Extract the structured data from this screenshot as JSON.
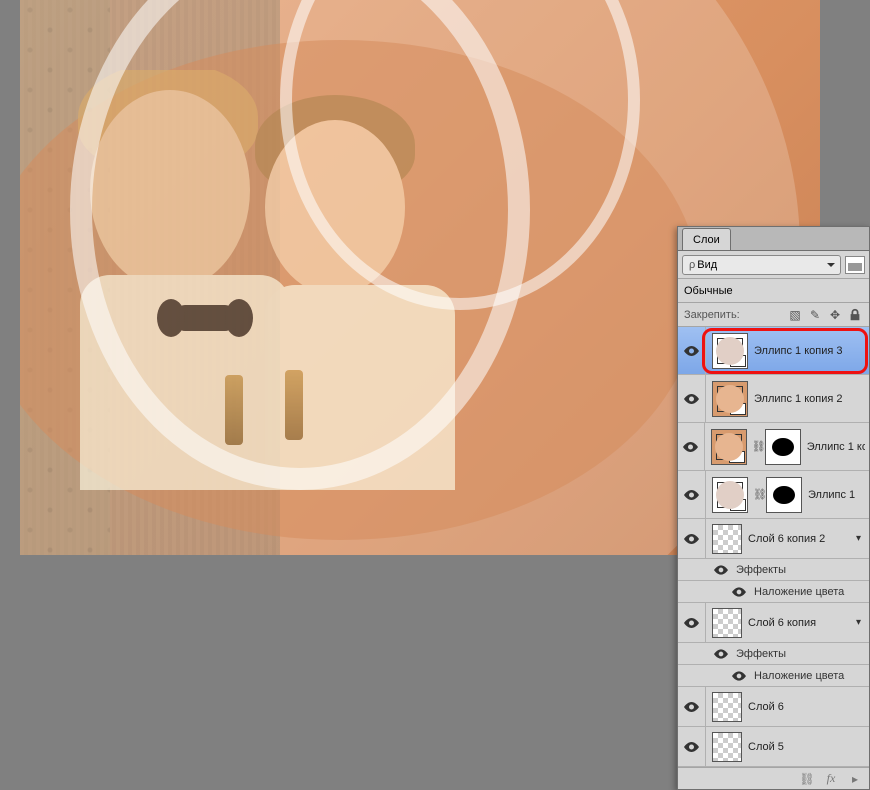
{
  "panel": {
    "tab_label": "Слои",
    "filter_prefix": "ρ",
    "filter_label": "Вид",
    "blend_mode": "Обычные",
    "lock_label": "Закрепить:"
  },
  "layers": [
    {
      "name": "Эллипс 1 копия 3",
      "selected": true,
      "type": "shape"
    },
    {
      "name": "Эллипс 1 копия 2",
      "selected": false,
      "type": "shape-brown"
    },
    {
      "name": "Эллипс 1 ко",
      "selected": false,
      "type": "shape-masked"
    },
    {
      "name": "Эллипс 1",
      "selected": false,
      "type": "shape-masked"
    },
    {
      "name": "Слой 6 копия 2",
      "selected": false,
      "type": "raster-fx",
      "fx_label": "Эффекты",
      "fx_items": [
        "Наложение цвета"
      ]
    },
    {
      "name": "Слой 6 копия",
      "selected": false,
      "type": "raster-fx",
      "fx_label": "Эффекты",
      "fx_items": [
        "Наложение цвета"
      ]
    },
    {
      "name": "Слой 6",
      "selected": false,
      "type": "raster"
    },
    {
      "name": "Слой 5",
      "selected": false,
      "type": "raster"
    }
  ]
}
